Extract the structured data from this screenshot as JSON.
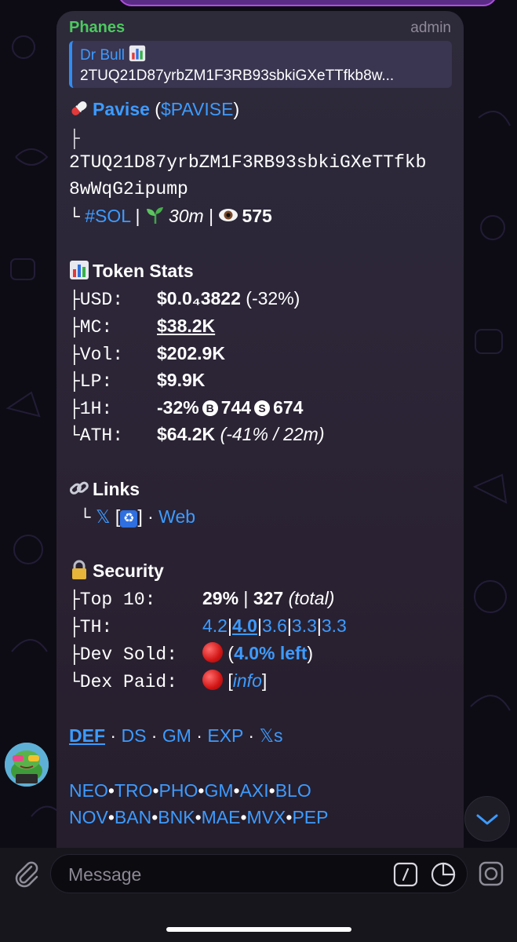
{
  "message": {
    "sender": "Phanes",
    "role": "admin",
    "reply": {
      "name": "Dr Bull",
      "text": "2TUQ21D87yrbZM1F3RB93sbkiGXeTTfkb8w..."
    },
    "token": {
      "name": "Pavise",
      "ticker": "$PAVISE",
      "address_line1": "2TUQ21D87yrbZM1F3RB93sbkiGXeTTfkb",
      "address_line2": "8wWqG2ipump",
      "chain": "#SOL",
      "age": "30m",
      "views": "575"
    },
    "stats": {
      "heading": "Token Stats",
      "usd_label": "├USD:",
      "usd_value": "$0.0₄3822",
      "usd_change": "(-32%)",
      "mc_label": "├MC:",
      "mc_value": "$38.2K",
      "vol_label": "├Vol:",
      "vol_value": "$202.9K",
      "lp_label": "├LP:",
      "lp_value": "$9.9K",
      "h1_label": "├1H:",
      "h1_change": "-32%",
      "buys_icon": "B",
      "buys": "744",
      "sells_icon": "S",
      "sells": "674",
      "ath_label": "└ATH:",
      "ath_value": "$64.2K",
      "ath_detail": "(-41% / 22m)"
    },
    "links": {
      "heading": "Links",
      "x_label": "𝕏",
      "recycle_label": "♻",
      "web_label": "Web"
    },
    "security": {
      "heading": "Security",
      "top10_label": "├Top 10:",
      "top10_value": "29%",
      "holders": "327",
      "holders_note": "(total)",
      "th_label": "├TH:",
      "th_values": [
        "4.2",
        "4.0",
        "3.6",
        "3.3",
        "3.3"
      ],
      "dev_label": "├Dev Sold:",
      "dev_left": "4.0% left",
      "dex_label": "└Dex Paid:",
      "dex_info": "info"
    },
    "actions": [
      "DEF",
      "DS",
      "GM",
      "EXP",
      "𝕏s"
    ],
    "bots_row1": [
      "NEO",
      "TRO",
      "PHO",
      "GM",
      "AXI",
      "BLO"
    ],
    "bots_row2": [
      "NOV",
      "BAN",
      "BNK",
      "MAE",
      "MVX",
      "PEP"
    ]
  },
  "composer": {
    "placeholder": "Message"
  },
  "colors": {
    "link": "#3d9bff",
    "sender": "#4cc95e",
    "bubble": "#2c2638"
  }
}
